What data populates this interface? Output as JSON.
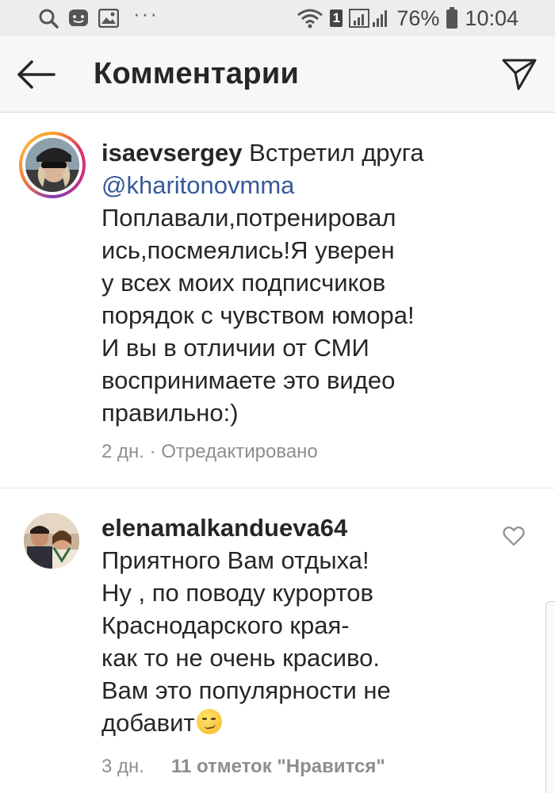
{
  "status_bar": {
    "left_icons": [
      "search-icon",
      "messenger-icon",
      "gallery-icon",
      "more-dots-icon"
    ],
    "more_dots": "···",
    "sim_badge": "1",
    "battery_percent": "76%",
    "time": "10:04"
  },
  "header": {
    "title": "Комментарии",
    "back_icon": "back-arrow-icon",
    "share_icon": "direct-send-icon"
  },
  "caption": {
    "username": "isaevsergey",
    "text_first": "Встретил друга",
    "mention": "@kharitonovmma",
    "text_rest": "Поплавали,потренировал\nись,посмеялись!Я уверен\nу всех моих подписчиков\nпорядок с чувством юмора!\nИ вы в отличии от СМИ\nвоспринимаете это видео\nправильно:)",
    "time": "2 дн.",
    "separator": "·",
    "edited": "Отредактировано"
  },
  "reply": {
    "username": "elenamalkandueva64",
    "text": "Приятного Вам отдыха!\nНу , по поводу курортов\nКраснодарского края-\nкак то не очень красиво.\nВам это популярности не\nдобавит",
    "emoji": "smirking-face-emoji",
    "time": "3 дн.",
    "likes": "11 отметок \"Нравится\"",
    "heart_icon": "heart-outline-icon"
  },
  "colors": {
    "header_bg": "#f7f7f7",
    "status_bg": "#ededed",
    "mention": "#385898",
    "meta": "#8e8e8e",
    "text": "#262626"
  }
}
